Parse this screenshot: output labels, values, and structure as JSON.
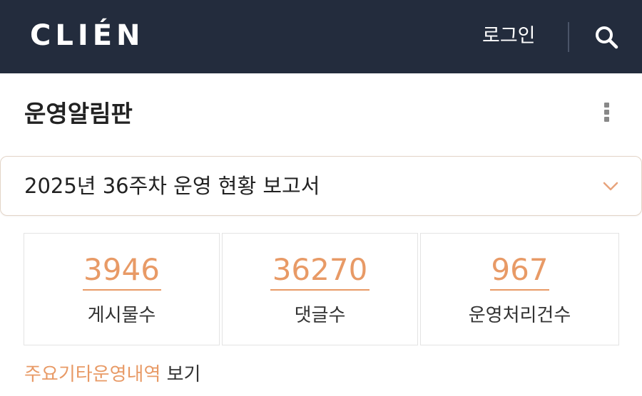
{
  "header": {
    "logo_text": "CLIÉN",
    "login_label": "로그인",
    "search_icon": "search-icon",
    "background_color": "#232c3d"
  },
  "board": {
    "title": "운영알림판",
    "more_icon": "more-vertical-icon"
  },
  "report": {
    "title": "2025년 36주차 운영 현황 보고서",
    "toggle_icon": "chevron-down-icon"
  },
  "stats": [
    {
      "value": "3946",
      "label": "게시물수"
    },
    {
      "value": "36270",
      "label": "댓글수"
    },
    {
      "value": "967",
      "label": "운영처리건수"
    }
  ],
  "footer": {
    "link_accent": "주요기타운영내역",
    "link_suffix": " 보기"
  },
  "colors": {
    "accent": "#e89a66",
    "header_bg": "#232c3d"
  }
}
